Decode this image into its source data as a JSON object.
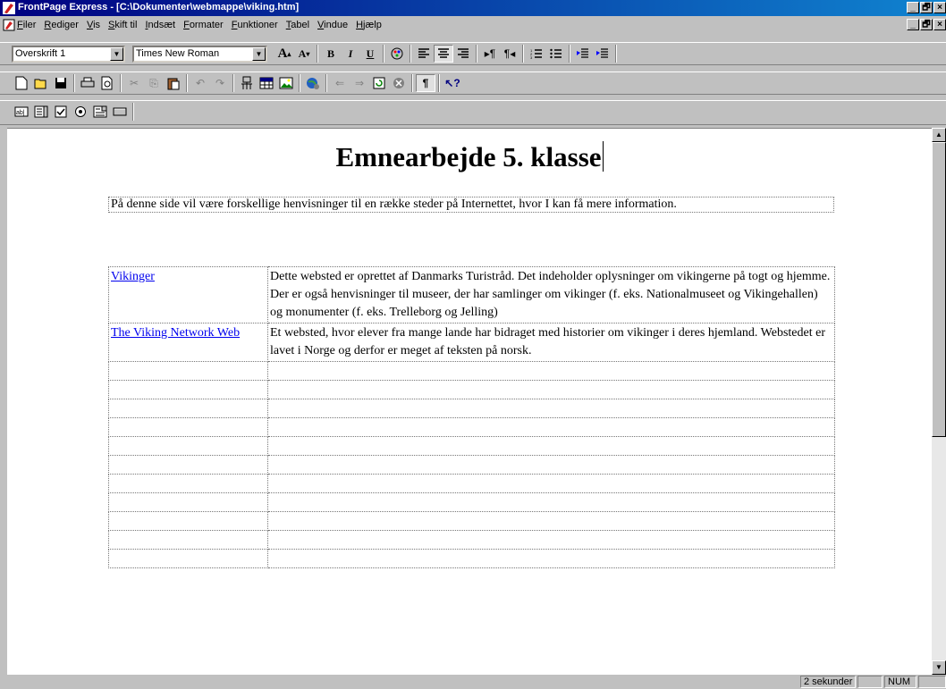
{
  "window": {
    "title": "FrontPage Express - [C:\\Dokumenter\\webmappe\\viking.htm]",
    "controls": [
      "_",
      "🗗",
      "×"
    ]
  },
  "menu": {
    "items": [
      "Filer",
      "Rediger",
      "Vis",
      "Skift til",
      "Indsæt",
      "Formater",
      "Funktioner",
      "Tabel",
      "Vindue",
      "Hjælp"
    ]
  },
  "format_toolbar": {
    "style_value": "Overskrift 1",
    "font_value": "Times New Roman",
    "bold": "B",
    "italic": "I",
    "underline": "U"
  },
  "document": {
    "heading": "Emnearbejde 5. klasse",
    "intro": "På denne side vil være forskellige henvisninger til en række steder på Internettet, hvor I kan få mere information.",
    "links": [
      {
        "link": "Vikinger",
        "description": "Dette websted er oprettet af Danmarks Turistråd. Det indeholder oplysninger om vikingerne på togt og hjemme. Der er også henvisninger til museer, der har samlinger om vikinger (f. eks. Nationalmuseet og Vikingehallen) og monumenter (f. eks. Trelleborg og Jelling)"
      },
      {
        "link": "The Viking Network Web",
        "description": "Et websted, hvor elever fra mange lande har bidraget med historier om vikinger i deres hjemland. Webstedet er lavet i Norge og derfor er meget af teksten på norsk."
      }
    ],
    "empty_rows": 11
  },
  "status": {
    "load_time": "2 sekunder",
    "num": "NUM"
  },
  "colors": {
    "titlebar": "#000080",
    "link": "#0000ee",
    "chrome": "#c0c0c0"
  }
}
